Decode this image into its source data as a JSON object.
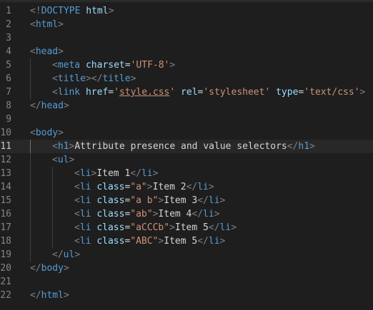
{
  "theme": {
    "background": "#1e1e1e",
    "line_number": "#858585",
    "punctuation": "#808080",
    "tag": "#569cd6",
    "attribute": "#9cdcfe",
    "string": "#ce9178",
    "text": "#d4d4d4"
  },
  "editor": {
    "active_line": 11,
    "lines": [
      {
        "number": "1",
        "indent": 0,
        "tokens": [
          {
            "type": "punc",
            "text": "<!"
          },
          {
            "type": "tag",
            "text": "DOCTYPE"
          },
          {
            "type": "attr",
            "text": " html"
          },
          {
            "type": "punc",
            "text": ">"
          }
        ]
      },
      {
        "number": "2",
        "indent": 0,
        "tokens": [
          {
            "type": "punc",
            "text": "<"
          },
          {
            "type": "tag",
            "text": "html"
          },
          {
            "type": "punc",
            "text": ">"
          }
        ]
      },
      {
        "number": "3",
        "indent": 0,
        "tokens": []
      },
      {
        "number": "4",
        "indent": 0,
        "tokens": [
          {
            "type": "punc",
            "text": "<"
          },
          {
            "type": "tag",
            "text": "head"
          },
          {
            "type": "punc",
            "text": ">"
          }
        ]
      },
      {
        "number": "5",
        "indent": 1,
        "tokens": [
          {
            "type": "punc",
            "text": "<"
          },
          {
            "type": "tag",
            "text": "meta"
          },
          {
            "type": "text",
            "text": " "
          },
          {
            "type": "attr",
            "text": "charset"
          },
          {
            "type": "text",
            "text": "="
          },
          {
            "type": "str",
            "text": "'UTF-8'"
          },
          {
            "type": "punc",
            "text": ">"
          }
        ]
      },
      {
        "number": "6",
        "indent": 1,
        "tokens": [
          {
            "type": "punc",
            "text": "<"
          },
          {
            "type": "tag",
            "text": "title"
          },
          {
            "type": "punc",
            "text": "></"
          },
          {
            "type": "tag",
            "text": "title"
          },
          {
            "type": "punc",
            "text": ">"
          }
        ]
      },
      {
        "number": "7",
        "indent": 1,
        "tokens": [
          {
            "type": "punc",
            "text": "<"
          },
          {
            "type": "tag",
            "text": "link"
          },
          {
            "type": "text",
            "text": " "
          },
          {
            "type": "attr",
            "text": "href"
          },
          {
            "type": "text",
            "text": "="
          },
          {
            "type": "str",
            "text": "'"
          },
          {
            "type": "link",
            "text": "style.css"
          },
          {
            "type": "str",
            "text": "'"
          },
          {
            "type": "text",
            "text": " "
          },
          {
            "type": "attr",
            "text": "rel"
          },
          {
            "type": "text",
            "text": "="
          },
          {
            "type": "str",
            "text": "'stylesheet'"
          },
          {
            "type": "text",
            "text": " "
          },
          {
            "type": "attr",
            "text": "type"
          },
          {
            "type": "text",
            "text": "="
          },
          {
            "type": "str",
            "text": "'text/css'"
          },
          {
            "type": "punc",
            "text": ">"
          }
        ]
      },
      {
        "number": "8",
        "indent": 0,
        "tokens": [
          {
            "type": "punc",
            "text": "</"
          },
          {
            "type": "tag",
            "text": "head"
          },
          {
            "type": "punc",
            "text": ">"
          }
        ]
      },
      {
        "number": "9",
        "indent": 0,
        "tokens": []
      },
      {
        "number": "10",
        "indent": 0,
        "tokens": [
          {
            "type": "punc",
            "text": "<"
          },
          {
            "type": "tag",
            "text": "body"
          },
          {
            "type": "punc",
            "text": ">"
          }
        ]
      },
      {
        "number": "11",
        "indent": 1,
        "tokens": [
          {
            "type": "punc",
            "text": "<"
          },
          {
            "type": "tag",
            "text": "h1"
          },
          {
            "type": "punc",
            "text": ">"
          },
          {
            "type": "text",
            "text": "Attribute presence and value selectors"
          },
          {
            "type": "punc",
            "text": "</"
          },
          {
            "type": "tag",
            "text": "h1"
          },
          {
            "type": "punc",
            "text": ">"
          }
        ]
      },
      {
        "number": "12",
        "indent": 1,
        "tokens": [
          {
            "type": "punc",
            "text": "<"
          },
          {
            "type": "tag",
            "text": "ul"
          },
          {
            "type": "punc",
            "text": ">"
          }
        ]
      },
      {
        "number": "13",
        "indent": 2,
        "tokens": [
          {
            "type": "punc",
            "text": "<"
          },
          {
            "type": "tag",
            "text": "li"
          },
          {
            "type": "punc",
            "text": ">"
          },
          {
            "type": "text",
            "text": "Item 1"
          },
          {
            "type": "punc",
            "text": "</"
          },
          {
            "type": "tag",
            "text": "li"
          },
          {
            "type": "punc",
            "text": ">"
          }
        ]
      },
      {
        "number": "14",
        "indent": 2,
        "tokens": [
          {
            "type": "punc",
            "text": "<"
          },
          {
            "type": "tag",
            "text": "li"
          },
          {
            "type": "text",
            "text": " "
          },
          {
            "type": "attr",
            "text": "class"
          },
          {
            "type": "text",
            "text": "="
          },
          {
            "type": "str",
            "text": "\"a\""
          },
          {
            "type": "punc",
            "text": ">"
          },
          {
            "type": "text",
            "text": "Item 2"
          },
          {
            "type": "punc",
            "text": "</"
          },
          {
            "type": "tag",
            "text": "li"
          },
          {
            "type": "punc",
            "text": ">"
          }
        ]
      },
      {
        "number": "15",
        "indent": 2,
        "tokens": [
          {
            "type": "punc",
            "text": "<"
          },
          {
            "type": "tag",
            "text": "li"
          },
          {
            "type": "text",
            "text": " "
          },
          {
            "type": "attr",
            "text": "class"
          },
          {
            "type": "text",
            "text": "="
          },
          {
            "type": "str",
            "text": "\"a b\""
          },
          {
            "type": "punc",
            "text": ">"
          },
          {
            "type": "text",
            "text": "Item 3"
          },
          {
            "type": "punc",
            "text": "</"
          },
          {
            "type": "tag",
            "text": "li"
          },
          {
            "type": "punc",
            "text": ">"
          }
        ]
      },
      {
        "number": "16",
        "indent": 2,
        "tokens": [
          {
            "type": "punc",
            "text": "<"
          },
          {
            "type": "tag",
            "text": "li"
          },
          {
            "type": "text",
            "text": " "
          },
          {
            "type": "attr",
            "text": "class"
          },
          {
            "type": "text",
            "text": "="
          },
          {
            "type": "str",
            "text": "\"ab\""
          },
          {
            "type": "punc",
            "text": ">"
          },
          {
            "type": "text",
            "text": "Item 4"
          },
          {
            "type": "punc",
            "text": "</"
          },
          {
            "type": "tag",
            "text": "li"
          },
          {
            "type": "punc",
            "text": ">"
          }
        ]
      },
      {
        "number": "17",
        "indent": 2,
        "tokens": [
          {
            "type": "punc",
            "text": "<"
          },
          {
            "type": "tag",
            "text": "li"
          },
          {
            "type": "text",
            "text": " "
          },
          {
            "type": "attr",
            "text": "class"
          },
          {
            "type": "text",
            "text": "="
          },
          {
            "type": "str",
            "text": "\"aCCCb\""
          },
          {
            "type": "punc",
            "text": ">"
          },
          {
            "type": "text",
            "text": "Item 5"
          },
          {
            "type": "punc",
            "text": "</"
          },
          {
            "type": "tag",
            "text": "li"
          },
          {
            "type": "punc",
            "text": ">"
          }
        ]
      },
      {
        "number": "18",
        "indent": 2,
        "tokens": [
          {
            "type": "punc",
            "text": "<"
          },
          {
            "type": "tag",
            "text": "li"
          },
          {
            "type": "text",
            "text": " "
          },
          {
            "type": "attr",
            "text": "class"
          },
          {
            "type": "text",
            "text": "="
          },
          {
            "type": "str",
            "text": "\"ABC\""
          },
          {
            "type": "punc",
            "text": ">"
          },
          {
            "type": "text",
            "text": "Item 5"
          },
          {
            "type": "punc",
            "text": "</"
          },
          {
            "type": "tag",
            "text": "li"
          },
          {
            "type": "punc",
            "text": ">"
          }
        ]
      },
      {
        "number": "19",
        "indent": 1,
        "tokens": [
          {
            "type": "punc",
            "text": "</"
          },
          {
            "type": "tag",
            "text": "ul"
          },
          {
            "type": "punc",
            "text": ">"
          }
        ]
      },
      {
        "number": "20",
        "indent": 0,
        "tokens": [
          {
            "type": "punc",
            "text": "</"
          },
          {
            "type": "tag",
            "text": "body"
          },
          {
            "type": "punc",
            "text": ">"
          }
        ]
      },
      {
        "number": "21",
        "indent": 0,
        "tokens": []
      },
      {
        "number": "22",
        "indent": 0,
        "tokens": [
          {
            "type": "punc",
            "text": "</"
          },
          {
            "type": "tag",
            "text": "html"
          },
          {
            "type": "punc",
            "text": ">"
          }
        ]
      }
    ]
  }
}
